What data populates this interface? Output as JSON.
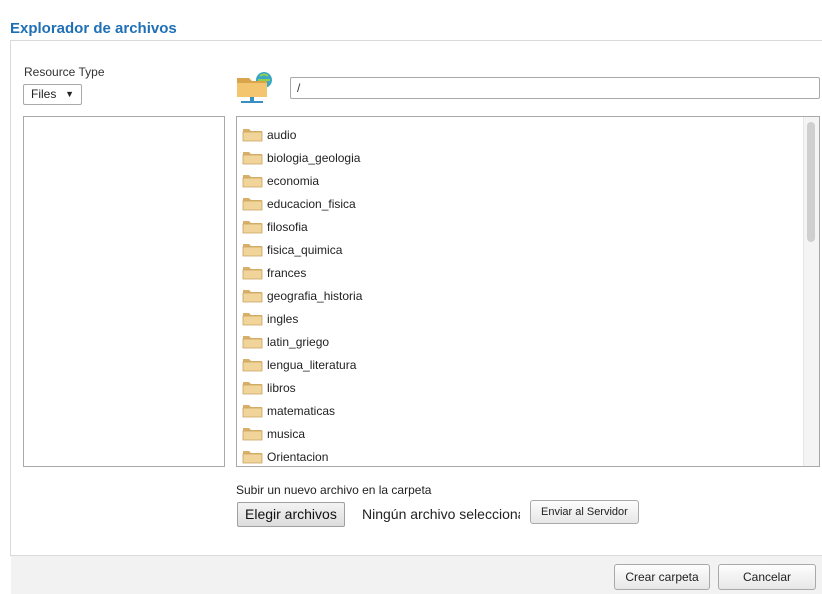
{
  "window": {
    "title": "Explorador de archivos"
  },
  "resource_type": {
    "label": "Resource Type",
    "selected": "Files"
  },
  "path": {
    "value": "/"
  },
  "folders": [
    "audio",
    "biologia_geologia",
    "economia",
    "educacion_fisica",
    "filosofia",
    "fisica_quimica",
    "frances",
    "geografia_historia",
    "ingles",
    "latin_griego",
    "lengua_literatura",
    "libros",
    "matematicas",
    "musica",
    "Orientacion"
  ],
  "upload": {
    "label": "Subir un nuevo archivo en la carpeta",
    "choose_label": "Elegir archivos",
    "no_file_text": "Ningún archivo seleccionado",
    "send_label": "Enviar al Servidor"
  },
  "footer": {
    "create_folder_label": "Crear carpeta",
    "cancel_label": "Cancelar"
  },
  "colors": {
    "title": "#1f6fb5",
    "folder": "#e9c98c",
    "footer_bg": "#f2f2f2"
  },
  "icons": {
    "folder": "folder-icon",
    "network_folder": "network-folder-icon",
    "dropdown": "chevron-down-icon"
  }
}
